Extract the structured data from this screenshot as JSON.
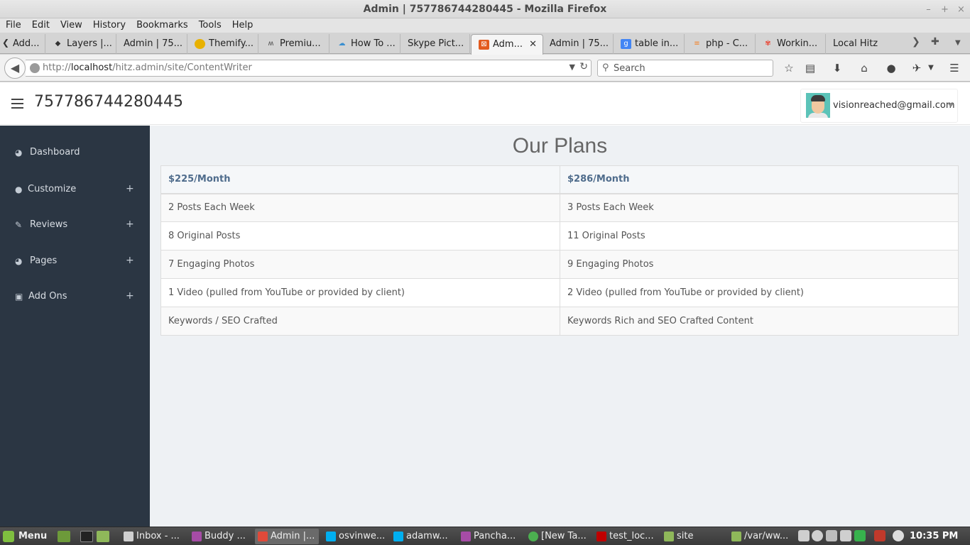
{
  "window": {
    "title": "Admin | 757786744280445 - Mozilla Firefox",
    "controls": [
      "–",
      "+",
      "×"
    ]
  },
  "menubar": [
    "File",
    "Edit",
    "View",
    "History",
    "Bookmarks",
    "Tools",
    "Help"
  ],
  "tabs": [
    {
      "label": "Add...",
      "icon": "generic-page-icon",
      "color": "#999999"
    },
    {
      "label": "Layers |...",
      "icon": "layers-icon",
      "color": "#333333"
    },
    {
      "label": "Admin | 75...",
      "icon": "none",
      "color": ""
    },
    {
      "label": "Themify...",
      "icon": "smiley-icon",
      "color": "#e8b100"
    },
    {
      "label": "Premiu...",
      "icon": "envato-icon",
      "color": "#555555"
    },
    {
      "label": "How To ...",
      "icon": "cloud-icon",
      "color": "#3a8fd0"
    },
    {
      "label": "Skype Pict...",
      "icon": "none",
      "color": ""
    },
    {
      "label": "Adm...",
      "icon": "xampp-icon",
      "color": "#e35b1f",
      "active": true
    },
    {
      "label": "Admin | 75...",
      "icon": "none",
      "color": ""
    },
    {
      "label": "table in...",
      "icon": "google-icon",
      "color": "#4285f4"
    },
    {
      "label": "php - C...",
      "icon": "stackoverflow-icon",
      "color": "#f48024"
    },
    {
      "label": "Workin...",
      "icon": "pinwheel-icon",
      "color": "#e84a3a"
    },
    {
      "label": "Local Hitz",
      "icon": "none",
      "color": ""
    }
  ],
  "navbar": {
    "url_prefix": "http://",
    "url_host": "localhost",
    "url_path": "/hitz.admin/site/ContentWriter",
    "search_placeholder": "Search"
  },
  "header": {
    "brand": "757786744280445",
    "user_email": "visionreached@gmail.com"
  },
  "sidebar": {
    "items": [
      {
        "label": "Dashboard",
        "icon": "dashboard-icon",
        "glyph": "◕",
        "expandable": false
      },
      {
        "label": "Customize",
        "icon": "user-icon",
        "glyph": "●",
        "expandable": true
      },
      {
        "label": "Reviews",
        "icon": "edit-icon",
        "glyph": "✎",
        "expandable": true
      },
      {
        "label": "Pages",
        "icon": "dashboard-icon",
        "glyph": "◕",
        "expandable": true
      },
      {
        "label": "Add Ons",
        "icon": "gift-icon",
        "glyph": "▣",
        "expandable": true
      }
    ],
    "expand_glyph": "+"
  },
  "main": {
    "title": "Our Plans",
    "plans_table": {
      "headers": [
        "$225/Month",
        "$286/Month"
      ],
      "rows": [
        [
          "2 Posts Each Week",
          "3 Posts Each Week"
        ],
        [
          "8 Original Posts",
          "11 Original Posts"
        ],
        [
          "7 Engaging Photos",
          "9 Engaging Photos"
        ],
        [
          "1 Video (pulled from YouTube or provided by client)",
          "2 Video (pulled from YouTube or provided by client)"
        ],
        [
          "Keywords / SEO Crafted",
          "Keywords Rich and SEO Crafted Content"
        ]
      ]
    }
  },
  "taskbar": {
    "menu_label": "Menu",
    "windows": [
      {
        "label": "Inbox - ...",
        "color": "#cfcfcf"
      },
      {
        "label": "Buddy ...",
        "color": "#a64ca6"
      },
      {
        "label": "Admin |...",
        "color": "#e04a3a",
        "active": true
      },
      {
        "label": "osvinwe...",
        "color": "#00aff0"
      },
      {
        "label": "adamw...",
        "color": "#00aff0"
      },
      {
        "label": "Pancha...",
        "color": "#a64ca6"
      },
      {
        "label": "[New Ta...",
        "color": "#4caf50"
      },
      {
        "label": "test_loc...",
        "color": "#bf0000"
      },
      {
        "label": "site",
        "color": "#8fb85a"
      },
      {
        "label": "/var/ww...",
        "color": "#8fb85a"
      }
    ],
    "clock": "10:35 PM"
  }
}
